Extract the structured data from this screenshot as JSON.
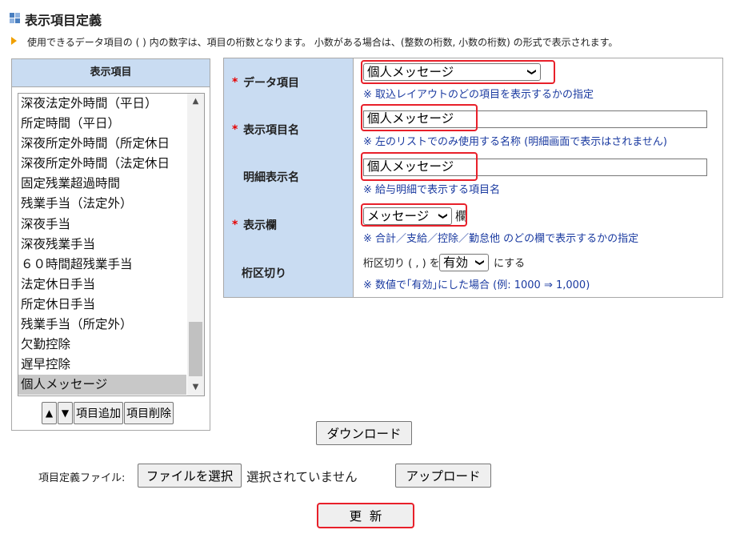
{
  "header": {
    "title": "表示項目定義",
    "note": "使用できるデータ項目の ( ) 内の数字は、項目の桁数となります。 小数がある場合は、(整数の桁数, 小数の桁数) の形式で表示されます。"
  },
  "left_panel": {
    "header": "表示項目",
    "items": [
      "深夜法定外時間（平日）",
      "所定時間（平日）",
      "深夜所定外時間（所定休日",
      "深夜所定外時間（法定休日",
      "固定残業超過時間",
      "残業手当（法定外）",
      "深夜手当",
      "深夜残業手当",
      "６０時間超残業手当",
      "法定休日手当",
      "所定休日手当",
      "残業手当（所定外）",
      "欠勤控除",
      "遅早控除",
      "個人メッセージ"
    ],
    "selected_item": "個人メッセージ",
    "up_label": "▲",
    "down_label": "▼",
    "add_label": "項目追加",
    "delete_label": "項目削除"
  },
  "form": {
    "required_mark": "*",
    "data_item": {
      "label": "データ項目",
      "value": "個人メッセージ",
      "hint": "※ 取込レイアウトのどの項目を表示するかの指定"
    },
    "display_name": {
      "label": "表示項目名",
      "value": "個人メッセージ",
      "hint": "※ 左のリストでのみ使用する名称 (明細画面で表示はされません)"
    },
    "detail_name": {
      "label": "明細表示名",
      "value": "個人メッセージ",
      "hint": "※ 給与明細で表示する項目名"
    },
    "display_column": {
      "label": "表示欄",
      "value": "メッセージ",
      "suffix": "欄",
      "hint": "※ 合計／支給／控除／勤怠他 のどの欄で表示するかの指定"
    },
    "separator": {
      "label": "桁区切り",
      "prefix": "桁区切り ( , ) を",
      "value": "有効",
      "suffix": "にする",
      "hint": "※ 数値で｢有効｣にした場合 (例: 1000 ⇒ 1,000)"
    }
  },
  "actions": {
    "download": "ダウンロード",
    "file_label": "項目定義ファイル:",
    "choose_file": "ファイルを選択",
    "no_file": "選択されていません",
    "upload": "アップロード",
    "update": "更  新"
  },
  "colors": {
    "label_bg": "#c9dcf2",
    "hint_text": "#1a3aa0",
    "required": "#e60000",
    "highlight": "#e8202a",
    "bullet": "#f0a000"
  }
}
